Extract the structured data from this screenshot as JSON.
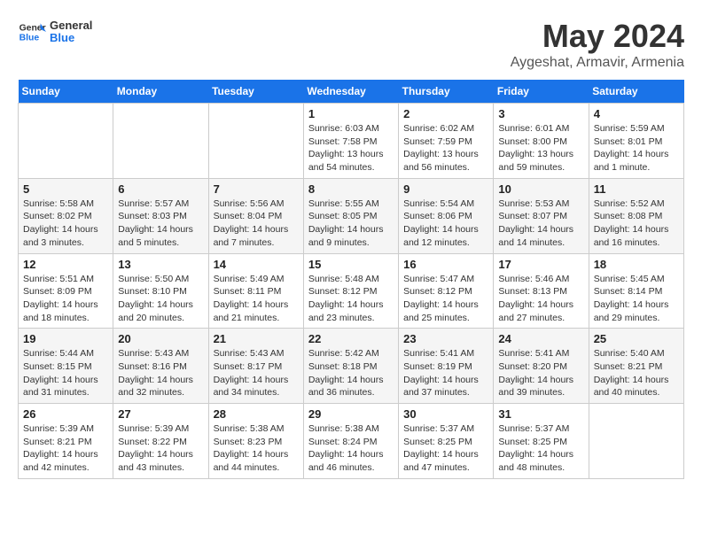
{
  "header": {
    "logo_general": "General",
    "logo_blue": "Blue",
    "month": "May 2024",
    "location": "Aygeshat, Armavir, Armenia"
  },
  "days_of_week": [
    "Sunday",
    "Monday",
    "Tuesday",
    "Wednesday",
    "Thursday",
    "Friday",
    "Saturday"
  ],
  "weeks": [
    {
      "cells": [
        {
          "day": null,
          "info": null
        },
        {
          "day": null,
          "info": null
        },
        {
          "day": null,
          "info": null
        },
        {
          "day": "1",
          "info": "Sunrise: 6:03 AM\nSunset: 7:58 PM\nDaylight: 13 hours and 54 minutes."
        },
        {
          "day": "2",
          "info": "Sunrise: 6:02 AM\nSunset: 7:59 PM\nDaylight: 13 hours and 56 minutes."
        },
        {
          "day": "3",
          "info": "Sunrise: 6:01 AM\nSunset: 8:00 PM\nDaylight: 13 hours and 59 minutes."
        },
        {
          "day": "4",
          "info": "Sunrise: 5:59 AM\nSunset: 8:01 PM\nDaylight: 14 hours and 1 minute."
        }
      ]
    },
    {
      "cells": [
        {
          "day": "5",
          "info": "Sunrise: 5:58 AM\nSunset: 8:02 PM\nDaylight: 14 hours and 3 minutes."
        },
        {
          "day": "6",
          "info": "Sunrise: 5:57 AM\nSunset: 8:03 PM\nDaylight: 14 hours and 5 minutes."
        },
        {
          "day": "7",
          "info": "Sunrise: 5:56 AM\nSunset: 8:04 PM\nDaylight: 14 hours and 7 minutes."
        },
        {
          "day": "8",
          "info": "Sunrise: 5:55 AM\nSunset: 8:05 PM\nDaylight: 14 hours and 9 minutes."
        },
        {
          "day": "9",
          "info": "Sunrise: 5:54 AM\nSunset: 8:06 PM\nDaylight: 14 hours and 12 minutes."
        },
        {
          "day": "10",
          "info": "Sunrise: 5:53 AM\nSunset: 8:07 PM\nDaylight: 14 hours and 14 minutes."
        },
        {
          "day": "11",
          "info": "Sunrise: 5:52 AM\nSunset: 8:08 PM\nDaylight: 14 hours and 16 minutes."
        }
      ]
    },
    {
      "cells": [
        {
          "day": "12",
          "info": "Sunrise: 5:51 AM\nSunset: 8:09 PM\nDaylight: 14 hours and 18 minutes."
        },
        {
          "day": "13",
          "info": "Sunrise: 5:50 AM\nSunset: 8:10 PM\nDaylight: 14 hours and 20 minutes."
        },
        {
          "day": "14",
          "info": "Sunrise: 5:49 AM\nSunset: 8:11 PM\nDaylight: 14 hours and 21 minutes."
        },
        {
          "day": "15",
          "info": "Sunrise: 5:48 AM\nSunset: 8:12 PM\nDaylight: 14 hours and 23 minutes."
        },
        {
          "day": "16",
          "info": "Sunrise: 5:47 AM\nSunset: 8:12 PM\nDaylight: 14 hours and 25 minutes."
        },
        {
          "day": "17",
          "info": "Sunrise: 5:46 AM\nSunset: 8:13 PM\nDaylight: 14 hours and 27 minutes."
        },
        {
          "day": "18",
          "info": "Sunrise: 5:45 AM\nSunset: 8:14 PM\nDaylight: 14 hours and 29 minutes."
        }
      ]
    },
    {
      "cells": [
        {
          "day": "19",
          "info": "Sunrise: 5:44 AM\nSunset: 8:15 PM\nDaylight: 14 hours and 31 minutes."
        },
        {
          "day": "20",
          "info": "Sunrise: 5:43 AM\nSunset: 8:16 PM\nDaylight: 14 hours and 32 minutes."
        },
        {
          "day": "21",
          "info": "Sunrise: 5:43 AM\nSunset: 8:17 PM\nDaylight: 14 hours and 34 minutes."
        },
        {
          "day": "22",
          "info": "Sunrise: 5:42 AM\nSunset: 8:18 PM\nDaylight: 14 hours and 36 minutes."
        },
        {
          "day": "23",
          "info": "Sunrise: 5:41 AM\nSunset: 8:19 PM\nDaylight: 14 hours and 37 minutes."
        },
        {
          "day": "24",
          "info": "Sunrise: 5:41 AM\nSunset: 8:20 PM\nDaylight: 14 hours and 39 minutes."
        },
        {
          "day": "25",
          "info": "Sunrise: 5:40 AM\nSunset: 8:21 PM\nDaylight: 14 hours and 40 minutes."
        }
      ]
    },
    {
      "cells": [
        {
          "day": "26",
          "info": "Sunrise: 5:39 AM\nSunset: 8:21 PM\nDaylight: 14 hours and 42 minutes."
        },
        {
          "day": "27",
          "info": "Sunrise: 5:39 AM\nSunset: 8:22 PM\nDaylight: 14 hours and 43 minutes."
        },
        {
          "day": "28",
          "info": "Sunrise: 5:38 AM\nSunset: 8:23 PM\nDaylight: 14 hours and 44 minutes."
        },
        {
          "day": "29",
          "info": "Sunrise: 5:38 AM\nSunset: 8:24 PM\nDaylight: 14 hours and 46 minutes."
        },
        {
          "day": "30",
          "info": "Sunrise: 5:37 AM\nSunset: 8:25 PM\nDaylight: 14 hours and 47 minutes."
        },
        {
          "day": "31",
          "info": "Sunrise: 5:37 AM\nSunset: 8:25 PM\nDaylight: 14 hours and 48 minutes."
        },
        {
          "day": null,
          "info": null
        }
      ]
    }
  ]
}
